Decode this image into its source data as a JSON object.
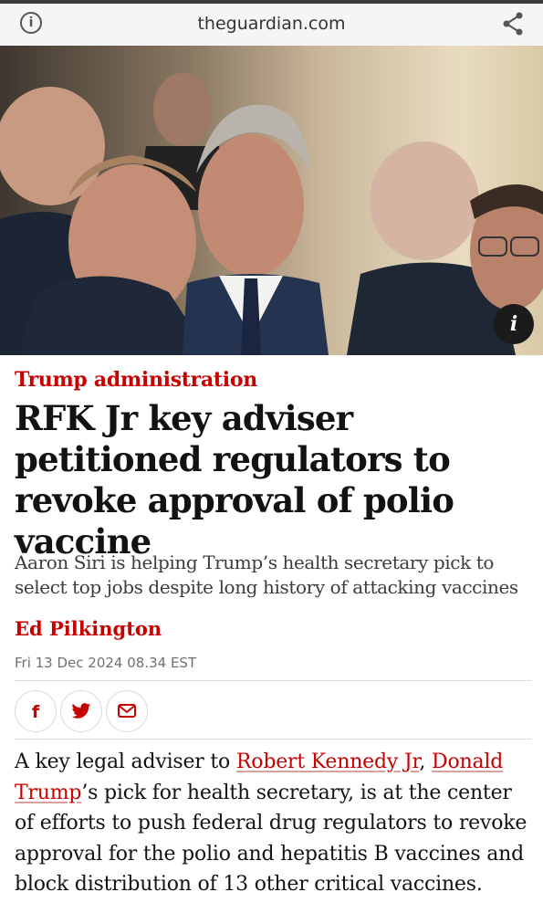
{
  "browser": {
    "url": "theguardian.com",
    "info_icon": "info-icon",
    "share_icon": "share-icon"
  },
  "hero": {
    "caption_button": "i"
  },
  "article": {
    "kicker": "Trump administration",
    "headline": "RFK Jr key adviser petitioned regulators to revoke approval of polio vaccine",
    "standfirst": "Aaron Siri is helping Trump’s health secretary pick to select top jobs despite long history of attacking vaccines",
    "byline": "Ed Pilkington",
    "dateline": "Fri 13 Dec 2024 08.34 EST",
    "share_buttons": [
      "facebook-icon",
      "twitter-icon",
      "email-icon"
    ],
    "body": {
      "p1_a": "A key legal adviser to ",
      "link1": "Robert Kennedy Jr",
      "p1_b": ", ",
      "link2": "Donald Trump",
      "p1_c": "’s pick for health secretary, is at the center of efforts to push federal drug regulators to revoke approval for the polio and hepatitis B vaccines and block distribution of 13 other critical vaccines."
    }
  },
  "colors": {
    "accent": "#c70000",
    "text": "#121212",
    "muted": "#707070"
  }
}
